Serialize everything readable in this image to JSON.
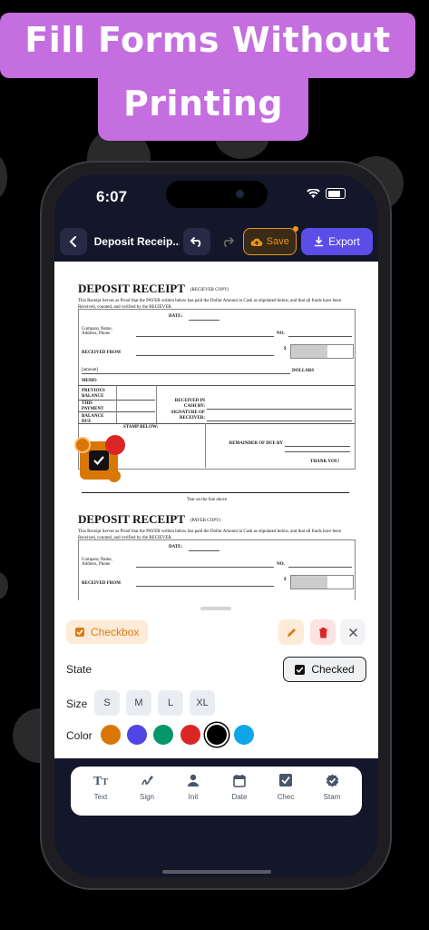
{
  "promo": {
    "line1": "Fill Forms Without",
    "line2": "Printing",
    "bg_color": "#c46ee0"
  },
  "status_bar": {
    "time": "6:07"
  },
  "toolbar": {
    "back_icon": "chevron-left-icon",
    "title": "Deposit Receip...",
    "undo_icon": "undo-icon",
    "redo_icon": "redo-icon",
    "save_label": "Save",
    "export_label": "Export",
    "save_color": "#e8951a",
    "export_color": "#5b4de8"
  },
  "document": {
    "receipt_top": {
      "title": "DEPOSIT RECEIPT",
      "subtitle": "(RECIEVER COPY)",
      "text": "This Receipt Serves as Proof that the PAYER written below has paid the Dollar Amount in Cash as stipulated below, and that all funds have been Received, counted, and verified by the RECIEVER."
    },
    "receipt_bottom": {
      "title": "DEPOSIT RECEIPT",
      "subtitle": "(PAYER COPY)",
      "text": "This Receipt Serves as Proof that the PAYER written below has paid the Dollar Amount in Cash as stipulated below, and that all funds have been Received, counted, and verified by the RECIEVER."
    },
    "labels": {
      "date": "DATE:",
      "company": "Company Name, Address, Phone",
      "no": "NO.",
      "received_from": "RECEIVED FROM",
      "dollar_sign": "$",
      "amount": "[amount]",
      "dollars": "DOLLARS",
      "memo": "MEMO",
      "previous_balance": "PREVIOUS BALANCE",
      "this_payment": "THIS PAYMENT",
      "balance_due": "BALANCE DUE",
      "received_in_cash_by": "RECEIVED IN CASH BY:",
      "signature_of_receiver": "SIGNATURE OF RECEIVER:",
      "stamp_below": "STAMP BELOW:",
      "remainder_due_by": "REMAINDER OF DUE BY",
      "thank_you": "THANK YOU!",
      "tear_line": "Tear on the line above"
    }
  },
  "panel": {
    "field_type_label": "Checkbox",
    "state_label": "State",
    "state_value": "Checked",
    "size_label": "Size",
    "sizes": [
      "S",
      "M",
      "L",
      "XL"
    ],
    "color_label": "Color",
    "colors": [
      "#d97706",
      "#4f46e5",
      "#059669",
      "#dc2626",
      "#000000",
      "#0ea5e9"
    ],
    "selected_color": "#000000"
  },
  "bottom_tabs": [
    {
      "label": "Text",
      "icon": "text-icon"
    },
    {
      "label": "Sign",
      "icon": "sign-icon"
    },
    {
      "label": "Init",
      "icon": "person-icon"
    },
    {
      "label": "Date",
      "icon": "calendar-icon"
    },
    {
      "label": "Chec",
      "icon": "checkbox-icon"
    },
    {
      "label": "Stam",
      "icon": "stamp-icon"
    }
  ]
}
